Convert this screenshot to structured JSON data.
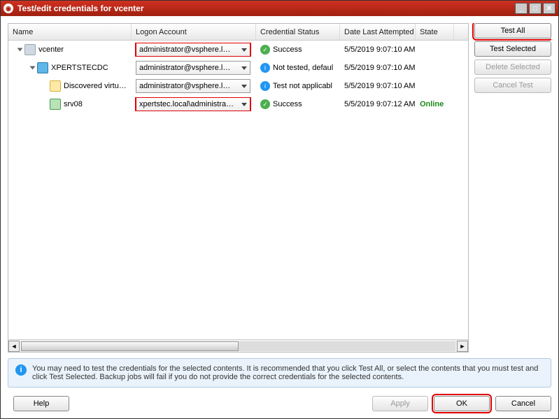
{
  "window": {
    "title": "Test/edit credentials for vcenter"
  },
  "columns": {
    "name": "Name",
    "logon": "Logon Account",
    "status": "Credential Status",
    "date": "Date Last Attempted",
    "state": "State"
  },
  "rows": [
    {
      "indent": 0,
      "expand": true,
      "icon": "ic-vc",
      "name": "vcenter",
      "logon": "administrator@vsphere.l…",
      "logon_red": true,
      "status_icon": "si-ok",
      "status": "Success",
      "date": "5/5/2019 9:07:10 AM",
      "state": ""
    },
    {
      "indent": 1,
      "expand": true,
      "icon": "ic-dc",
      "name": "XPERTSTECDC",
      "logon": "administrator@vsphere.l…",
      "logon_red": false,
      "status_icon": "si-info",
      "status": "Not tested, defaul",
      "date": "5/5/2019 9:07:10 AM",
      "state": ""
    },
    {
      "indent": 2,
      "expand": false,
      "icon": "ic-folder",
      "name": "Discovered virtu…",
      "logon": "administrator@vsphere.l…",
      "logon_red": false,
      "status_icon": "si-info",
      "status": "Test not applicabl",
      "date": "5/5/2019 9:07:10 AM",
      "state": ""
    },
    {
      "indent": 2,
      "expand": false,
      "icon": "ic-host",
      "name": "srv08",
      "logon": "xpertstec.local\\administra…",
      "logon_red": true,
      "status_icon": "si-ok",
      "status": "Success",
      "date": "5/5/2019 9:07:12 AM",
      "state": "Online"
    }
  ],
  "sidebuttons": {
    "test_all": "Test All",
    "test_selected": "Test Selected",
    "delete_selected": "Delete Selected",
    "cancel_test": "Cancel Test"
  },
  "info_text": "You may need to test the credentials for the selected contents. It is recommended that you click Test All, or select the contents that you must test and click Test Selected. Backup jobs will fail if you do not provide the correct credentials for the selected contents.",
  "footer": {
    "help": "Help",
    "apply": "Apply",
    "ok": "OK",
    "cancel": "Cancel"
  }
}
